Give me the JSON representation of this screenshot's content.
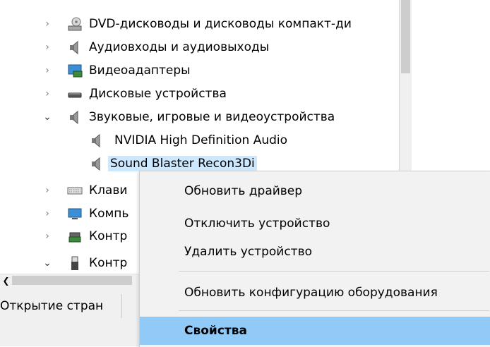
{
  "tree": {
    "items": [
      {
        "label": "DVD-дисководы и дисководы компакт-ди",
        "icon": "dvd-drive-icon",
        "expanded": false
      },
      {
        "label": "Аудиовходы и аудиовыходы",
        "icon": "speaker-icon",
        "expanded": false
      },
      {
        "label": "Видеоадаптеры",
        "icon": "display-adapter-icon",
        "expanded": false
      },
      {
        "label": "Дисковые устройства",
        "icon": "disk-drive-icon",
        "expanded": false
      },
      {
        "label": "Звуковые, игровые и видеоустройства",
        "icon": "speaker-icon",
        "expanded": true
      },
      {
        "label": "NVIDIA High Definition Audio",
        "icon": "speaker-icon"
      },
      {
        "label": "Sound Blaster Recon3Di",
        "icon": "speaker-icon",
        "selected": true
      },
      {
        "label": "Клави",
        "icon": "keyboard-icon",
        "expanded": false
      },
      {
        "label": "Компь",
        "icon": "monitor-icon",
        "expanded": false
      },
      {
        "label": "Контр",
        "icon": "controller-icon",
        "expanded": false
      },
      {
        "label": "Контр",
        "icon": "usb-icon",
        "expanded": true
      }
    ]
  },
  "status": {
    "text": "Открытие стран"
  },
  "context_menu": {
    "update_driver": "Обновить драйвер",
    "disable_device": "Отключить устройство",
    "uninstall_device": "Удалить устройство",
    "scan_hardware": "Обновить конфигурацию оборудования",
    "properties": "Свойства"
  },
  "colors": {
    "selection": "#cce8ff",
    "menu_highlight": "#91c9f7",
    "menu_bg": "#f2f2f2"
  }
}
